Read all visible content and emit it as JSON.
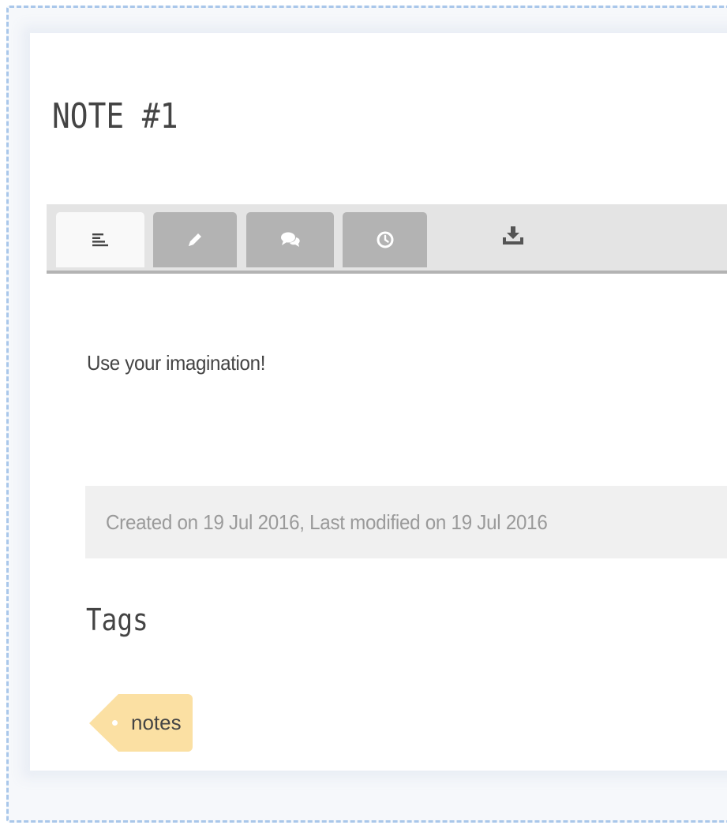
{
  "note": {
    "title": "NOTE #1",
    "body": "Use your imagination!",
    "meta": "Created on 19 Jul 2016, Last modified on 19 Jul 2016"
  },
  "tabs": [
    {
      "icon": "text-lines-icon",
      "active": true
    },
    {
      "icon": "pencil-icon",
      "active": false
    },
    {
      "icon": "comment-bubbles-icon",
      "active": false
    },
    {
      "icon": "clock-icon",
      "active": false
    },
    {
      "icon": "download-icon",
      "active": false
    }
  ],
  "tags": {
    "heading": "Tags",
    "items": [
      "notes"
    ]
  },
  "colors": {
    "tab_bar": "#e4e4e4",
    "tab_inactive": "#b3b3b3",
    "tab_active": "#f9f9f9",
    "meta_background": "#f0f0f0",
    "tag_background": "#fbe0a3",
    "frame_border": "#a9c7ea"
  }
}
